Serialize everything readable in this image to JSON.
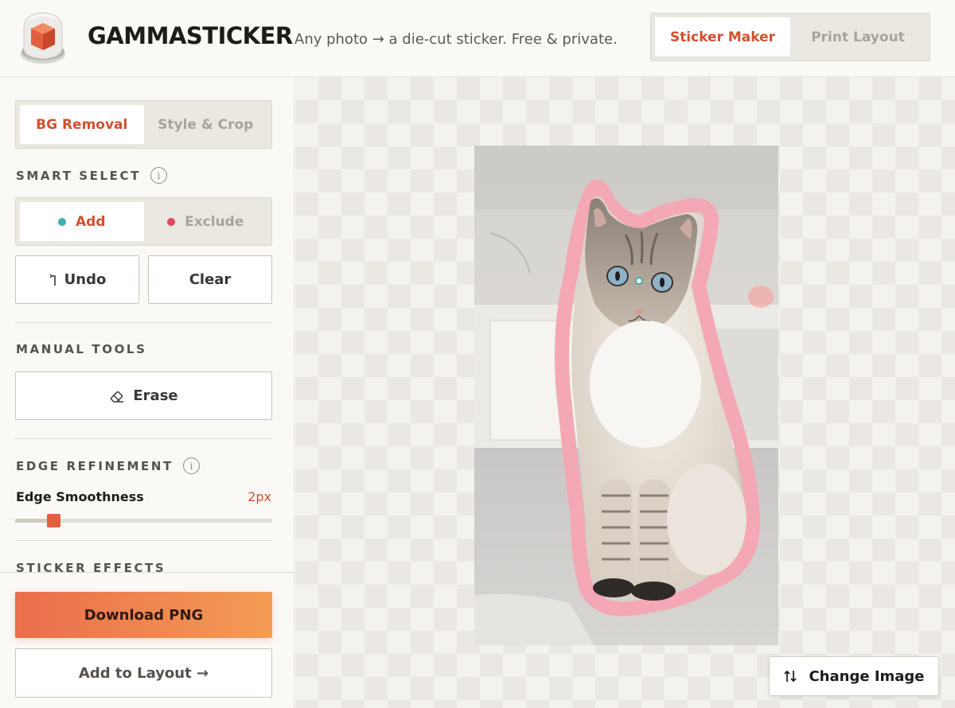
{
  "header": {
    "brand": "GAMMASTICKER",
    "tagline": "Any photo → a die-cut sticker. Free & private.",
    "tabs": [
      {
        "label": "Sticker Maker",
        "active": true
      },
      {
        "label": "Print Layout",
        "active": false
      }
    ]
  },
  "sidebar": {
    "tabs": [
      {
        "label": "BG Removal",
        "active": true
      },
      {
        "label": "Style & Crop",
        "active": false
      }
    ],
    "smart_select": {
      "title": "SMART SELECT",
      "modes": [
        {
          "label": "Add",
          "active": true,
          "dot_color": "#3fb0a6"
        },
        {
          "label": "Exclude",
          "active": false,
          "dot_color": "#e0485e"
        }
      ],
      "undo_label": "Undo",
      "clear_label": "Clear"
    },
    "manual_tools": {
      "title": "MANUAL TOOLS",
      "erase_label": "Erase"
    },
    "edge_refinement": {
      "title": "EDGE REFINEMENT",
      "smoothness_label": "Edge Smoothness",
      "smoothness_value": "2px",
      "smoothness_fraction": 0.15
    },
    "sticker_effects": {
      "title": "STICKER EFFECTS"
    },
    "download_label": "Download PNG",
    "add_to_layout_label": "Add to Layout →"
  },
  "canvas": {
    "change_image_label": "Change Image",
    "outline_color": "#f4a7b4",
    "accent_color": "#d34f2e"
  }
}
